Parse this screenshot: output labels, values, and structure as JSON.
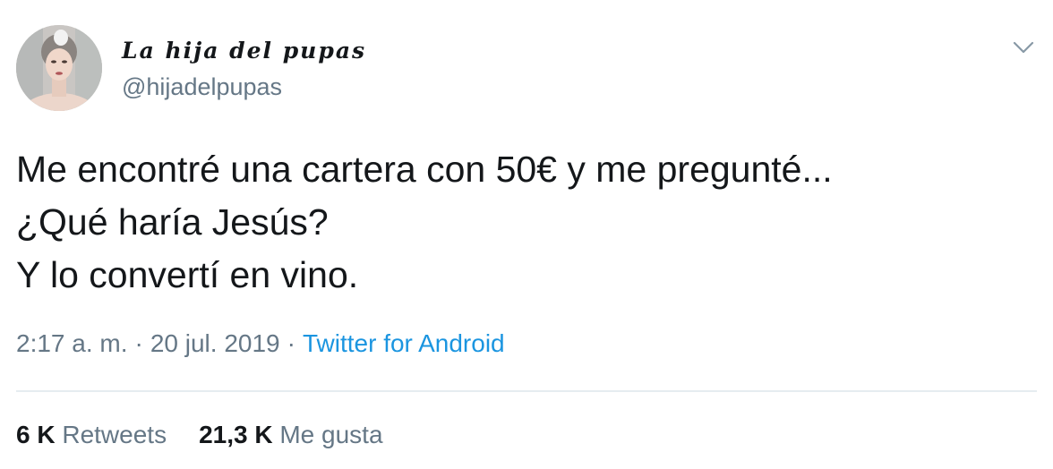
{
  "user": {
    "display_name": "La hija del pupas",
    "handle": "@hijadelpupas",
    "avatar_icon": "profile-photo"
  },
  "tweet": {
    "lines": [
      "Me encontré una cartera con 50€ y me pregunté...",
      "¿Qué haría Jesús?",
      "Y lo convertí en vino."
    ]
  },
  "meta": {
    "time": "2:17 a. m.",
    "separator": "·",
    "date": "20 jul. 2019",
    "source": "Twitter for Android"
  },
  "stats": {
    "retweets_count": "6 K",
    "retweets_label": "Retweets",
    "likes_count": "21,3 K",
    "likes_label": "Me gusta"
  },
  "icons": {
    "menu": "chevron-down-icon"
  },
  "colors": {
    "text": "#14171a",
    "secondary": "#657786",
    "link": "#1b95e0",
    "divider": "#e6ecf0"
  }
}
